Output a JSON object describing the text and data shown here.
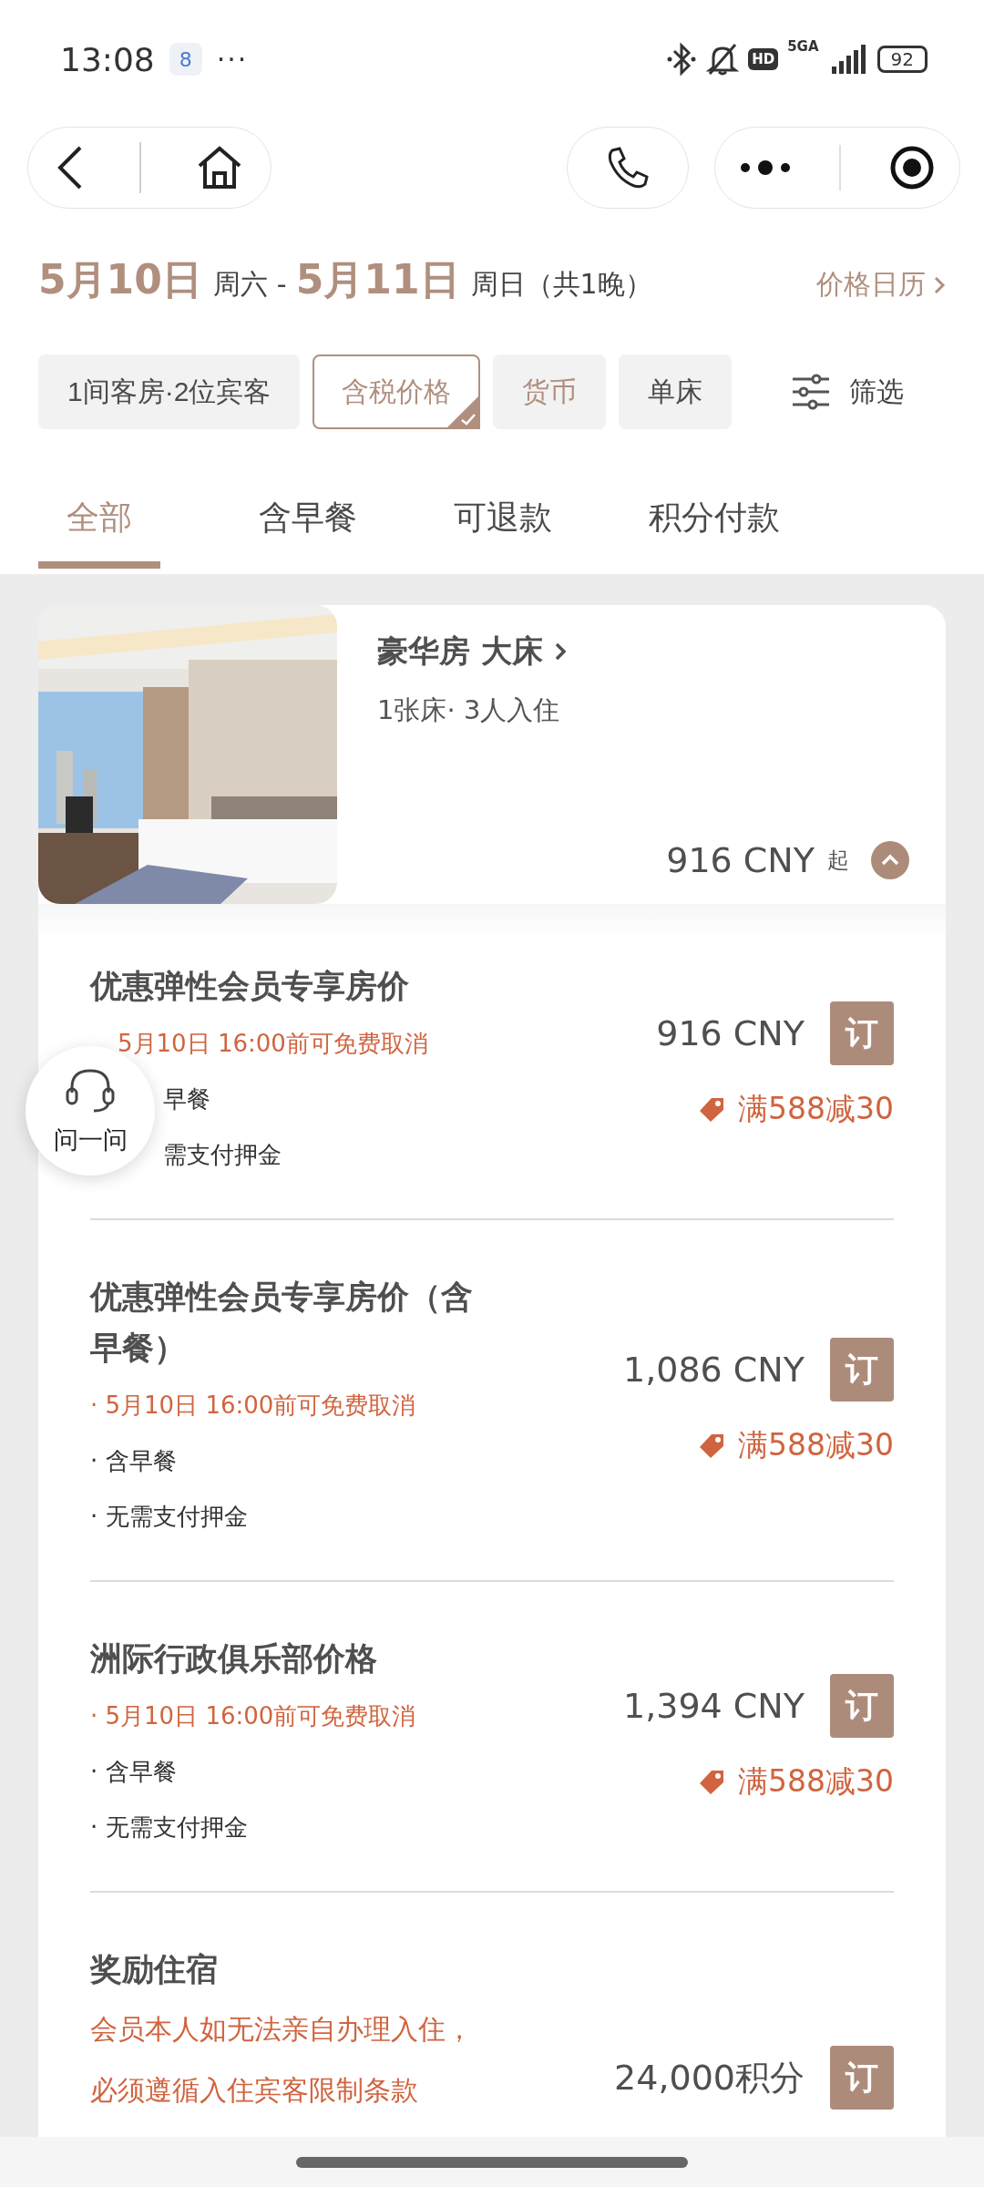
{
  "status_bar": {
    "time": "13:08",
    "app_badge": "8",
    "more": "···",
    "hd": "HD",
    "network": "5GA",
    "battery": "92"
  },
  "date_bar": {
    "check_in": "5月10日",
    "check_in_day": "周六",
    "separator": "-",
    "check_out": "5月11日",
    "check_out_day": "周日（共1晚）",
    "calendar_link": "价格日历"
  },
  "chips": [
    {
      "label": "1间客房·2位宾客",
      "selected": false,
      "highlighted": false
    },
    {
      "label": "含税价格",
      "selected": true,
      "highlighted": true
    },
    {
      "label": "货币",
      "selected": false,
      "highlighted": true
    },
    {
      "label": "单床",
      "selected": false,
      "highlighted": false
    }
  ],
  "filter_button": "筛选",
  "tabs": [
    {
      "label": "全部",
      "selected": true
    },
    {
      "label": "含早餐",
      "selected": false
    },
    {
      "label": "可退款",
      "selected": false
    },
    {
      "label": "积分付款",
      "selected": false
    }
  ],
  "room": {
    "kind": "picture",
    "title": "豪华房 大床",
    "subtitle": "1张床· 3人入住",
    "price": "916 CNY",
    "price_suffix": "起",
    "expanded": true
  },
  "rates": [
    {
      "name": "优惠弹性会员专享房价",
      "lines": [
        {
          "text": "5月10日 16:00前可免费取消",
          "kind": "cancel"
        },
        {
          "text": "早餐",
          "kind": "info"
        },
        {
          "text": "需支付押金",
          "kind": "info"
        }
      ],
      "price": "916 CNY",
      "book": "订",
      "discount": "满588减30"
    },
    {
      "name": "优惠弹性会员专享房价（含早餐）",
      "lines": [
        {
          "text": "· 5月10日 16:00前可免费取消",
          "kind": "cancel"
        },
        {
          "text": "· 含早餐",
          "kind": "info"
        },
        {
          "text": "· 无需支付押金",
          "kind": "info"
        }
      ],
      "price": "1,086 CNY",
      "book": "订",
      "discount": "满588减30"
    },
    {
      "name": "洲际行政俱乐部价格",
      "lines": [
        {
          "text": "· 5月10日 16:00前可免费取消",
          "kind": "cancel"
        },
        {
          "text": "· 含早餐",
          "kind": "info"
        },
        {
          "text": "· 无需支付押金",
          "kind": "info"
        }
      ],
      "price": "1,394 CNY",
      "book": "订",
      "discount": "满588减30"
    },
    {
      "name": "奖励住宿",
      "lines": [
        {
          "text": "会员本人如无法亲自办理入住，",
          "kind": "notice"
        },
        {
          "text": "必须遵循入住宾客限制条款",
          "kind": "notice"
        }
      ],
      "price": "24,000积分",
      "book": "订"
    }
  ],
  "assistant_button": "问一问"
}
